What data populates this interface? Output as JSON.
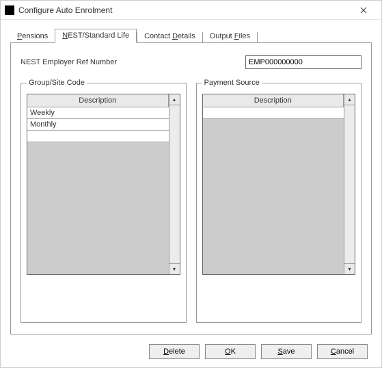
{
  "window": {
    "title": "Configure Auto Enrolment"
  },
  "tabs": {
    "pensions_pre": "",
    "pensions_hk": "P",
    "pensions_rest": "ensions",
    "nest_pre": "",
    "nest_hk": "N",
    "nest_rest": "EST/Standard Life",
    "contact_pre": "Contact ",
    "contact_hk": "D",
    "contact_rest": "etails",
    "output_pre": "Output ",
    "output_hk": "F",
    "output_rest": "iles"
  },
  "ref": {
    "label": "NEST Employer Ref Number",
    "value": "EMP000000000"
  },
  "groupSite": {
    "legend": "Group/Site Code",
    "header": "Description",
    "rows": [
      "Weekly",
      "Monthly"
    ]
  },
  "paymentSource": {
    "legend": "Payment Source",
    "header": "Description",
    "rows": []
  },
  "buttons": {
    "delete_pre": "",
    "delete_hk": "D",
    "delete_rest": "elete",
    "ok_pre": "",
    "ok_hk": "O",
    "ok_rest": "K",
    "save_pre": "",
    "save_hk": "S",
    "save_rest": "ave",
    "cancel_pre": "",
    "cancel_hk": "C",
    "cancel_rest": "ancel"
  }
}
